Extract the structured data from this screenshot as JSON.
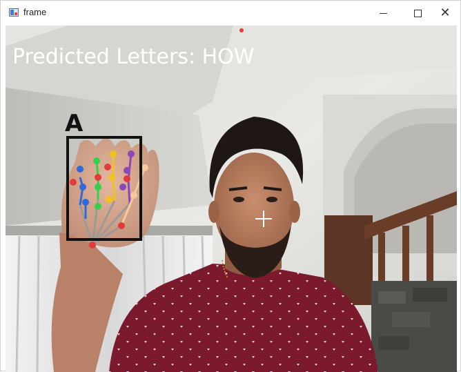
{
  "window": {
    "title": "frame"
  },
  "overlay": {
    "predicted_label": "Predicted Letters: HOW",
    "detected_sign": "A"
  },
  "colors": {
    "overlay_text": "#ffffff",
    "bbox": "#111111",
    "landmark_red": "#e23b3b",
    "landmark_blue": "#2f6ad6",
    "landmark_green": "#35d04a",
    "landmark_yellow": "#f3c21a",
    "landmark_purple": "#8a48b8",
    "landmark_peach": "#f6c89a",
    "connector": "#9a9a9a"
  },
  "icons": {
    "app": "window-app-icon",
    "minimize": "minimize-icon",
    "maximize": "maximize-icon",
    "close": "close-icon"
  }
}
